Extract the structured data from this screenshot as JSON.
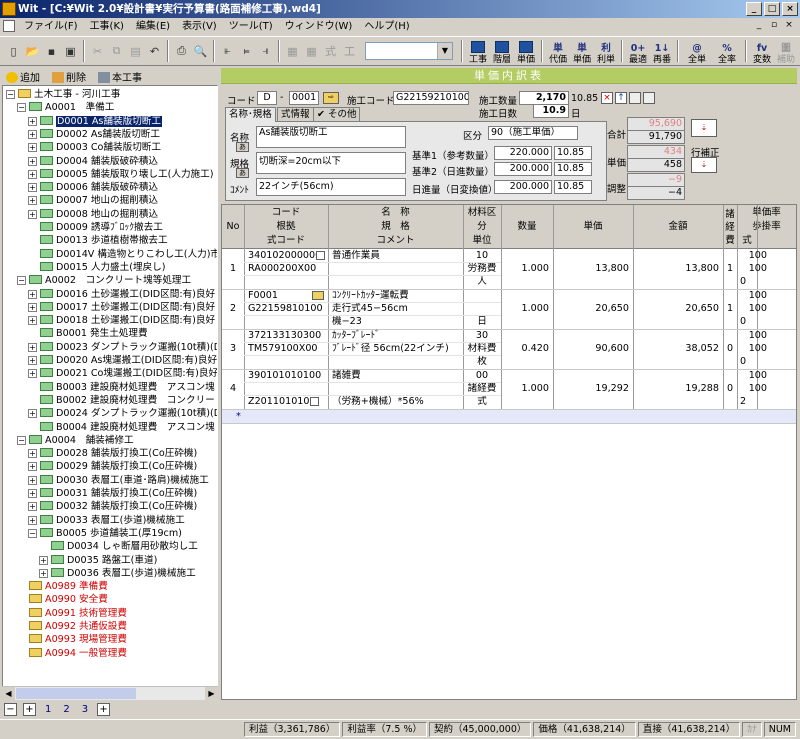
{
  "titlebar": {
    "title": "Wit - [C:¥Wit 2.0¥設計書¥実行予算書(路面補修工事).wd4]",
    "buttons": [
      "_",
      "□",
      "×"
    ]
  },
  "menu": [
    "ファイル(F)",
    "工事(K)",
    "編集(E)",
    "表示(V)",
    "ツール(T)",
    "ウィンドウ(W)",
    "ヘルプ(H)"
  ],
  "toolbar": {
    "big": [
      {
        "label": "工事",
        "icon": "grid-icon"
      },
      {
        "label": "階層",
        "icon": "grid-icon"
      },
      {
        "label": "単価",
        "icon": "grid-icon"
      },
      {
        "label": "代価",
        "glyph": "単",
        "icon": "table-icon"
      },
      {
        "label": "単価",
        "glyph": "単",
        "icon": "table-icon"
      },
      {
        "label": "利単",
        "glyph": "利",
        "icon": "table-icon"
      },
      {
        "label": "最適",
        "glyph": "0+",
        "icon": "optimize-icon"
      },
      {
        "label": "再番",
        "glyph": "1↓",
        "icon": "renumber-icon"
      },
      {
        "label": "全単",
        "glyph": "@",
        "icon": "at-icon"
      },
      {
        "label": "全率",
        "glyph": "%",
        "icon": "percent-icon"
      },
      {
        "label": "変数",
        "glyph": "fv",
        "icon": "variable-icon"
      },
      {
        "label": "補助",
        "glyph": "圖",
        "icon": "aux-icon"
      }
    ]
  },
  "left": {
    "add_label": "追加",
    "delete_label": "削除",
    "book_label": "本工事",
    "tree": [
      {
        "text": "土木工事 - 河川工事",
        "level": 0,
        "exp": "-",
        "folder": "y"
      },
      {
        "text": "A0001　準備工",
        "level": 1,
        "exp": "-",
        "folder": "g"
      },
      {
        "text": "D0001 As舗装版切断工",
        "level": 2,
        "exp": "+",
        "folder": "g",
        "selected": true
      },
      {
        "text": "D0002 As舗装版切断工",
        "level": 2,
        "exp": "+",
        "folder": "g"
      },
      {
        "text": "D0003 Co舗装版切断工",
        "level": 2,
        "exp": "+",
        "folder": "g"
      },
      {
        "text": "D0004 舗装版破砕積込",
        "level": 2,
        "exp": "+",
        "folder": "g"
      },
      {
        "text": "D0005 舗装版取り壊し工(人力施工)",
        "level": 2,
        "exp": "+",
        "folder": "g"
      },
      {
        "text": "D0006 舗装版破砕積込",
        "level": 2,
        "exp": "+",
        "folder": "g"
      },
      {
        "text": "D0007 地山の掘削積込",
        "level": 2,
        "exp": "+",
        "folder": "g"
      },
      {
        "text": "D0008 地山の掘削積込",
        "level": 2,
        "exp": "+",
        "folder": "g"
      },
      {
        "text": "D0009 誘導ﾌﾞﾛｯｸ撤去工",
        "level": 2,
        "exp": "",
        "folder": "g"
      },
      {
        "text": "D0013 歩道植樹帯撤去工",
        "level": 2,
        "exp": "",
        "folder": "g"
      },
      {
        "text": "D0014V 構造物とりこわし工(人力)市場単",
        "level": 2,
        "exp": "",
        "folder": "g"
      },
      {
        "text": "D0015 人力盛土(埋戻し)",
        "level": 2,
        "exp": "",
        "folder": "g"
      },
      {
        "text": "A0002　コンクリート塊等処理工",
        "level": 1,
        "exp": "-",
        "folder": "g"
      },
      {
        "text": "D0016 土砂運搬工(DID区間:有)良好",
        "level": 2,
        "exp": "+",
        "folder": "g"
      },
      {
        "text": "D0017 土砂運搬工(DID区間:有)良好",
        "level": 2,
        "exp": "+",
        "folder": "g"
      },
      {
        "text": "D0018 土砂運搬工(DID区間:有)良好",
        "level": 2,
        "exp": "+",
        "folder": "g"
      },
      {
        "text": "B0001 発生土処理費",
        "level": 2,
        "exp": "",
        "folder": "g"
      },
      {
        "text": "D0023 ダンプトラック運搬(10t積)(DID区間",
        "level": 2,
        "exp": "+",
        "folder": "g"
      },
      {
        "text": "D0020 As塊運搬工(DID区間:有)良好",
        "level": 2,
        "exp": "+",
        "folder": "g"
      },
      {
        "text": "D0021 Co塊運搬工(DID区間:有)良好",
        "level": 2,
        "exp": "+",
        "folder": "g"
      },
      {
        "text": "B0003 建設廃材処理費　アスコン塊",
        "level": 2,
        "exp": "",
        "folder": "g"
      },
      {
        "text": "B0002 建設廃材処理費　コンクリート塊(無",
        "level": 2,
        "exp": "",
        "folder": "g"
      },
      {
        "text": "D0024 ダンプトラック運搬(10t積)(DID区間",
        "level": 2,
        "exp": "+",
        "folder": "g"
      },
      {
        "text": "B0004 建設廃材処理費　アスコン塊",
        "level": 2,
        "exp": "",
        "folder": "g"
      },
      {
        "text": "A0004　舗装補修工",
        "level": 1,
        "exp": "-",
        "folder": "g"
      },
      {
        "text": "D0028 舗装版打換工(Co圧砕機)",
        "level": 2,
        "exp": "+",
        "folder": "g"
      },
      {
        "text": "D0029 舗装版打換工(Co圧砕機)",
        "level": 2,
        "exp": "+",
        "folder": "g"
      },
      {
        "text": "D0030 表層工(車道･路肩)機械施工",
        "level": 2,
        "exp": "+",
        "folder": "g"
      },
      {
        "text": "D0031 舗装版打換工(Co圧砕機)",
        "level": 2,
        "exp": "+",
        "folder": "g"
      },
      {
        "text": "D0032 舗装版打換工(Co圧砕機)",
        "level": 2,
        "exp": "+",
        "folder": "g"
      },
      {
        "text": "D0033 表層工(歩道)機械施工",
        "level": 2,
        "exp": "+",
        "folder": "g"
      },
      {
        "text": "B0005 歩道舗装工(厚19cm)",
        "level": 2,
        "exp": "-",
        "folder": "g"
      },
      {
        "text": "D0034 しゃ断層用砂散均し工",
        "level": 3,
        "exp": "",
        "folder": "g"
      },
      {
        "text": "D0035 路盤工(車道)",
        "level": 3,
        "exp": "+",
        "folder": "g"
      },
      {
        "text": "D0036 表層工(歩道)機械施工",
        "level": 3,
        "exp": "+",
        "folder": "g"
      },
      {
        "text": "A0989 準備費",
        "level": 1,
        "exp": "",
        "folder": "y",
        "red": true
      },
      {
        "text": "A0990 安全費",
        "level": 1,
        "exp": "",
        "folder": "y",
        "red": true
      },
      {
        "text": "A0991 技術管理費",
        "level": 1,
        "exp": "",
        "folder": "y",
        "red": true
      },
      {
        "text": "A0992 共通仮設費",
        "level": 1,
        "exp": "",
        "folder": "y",
        "red": true
      },
      {
        "text": "A0993 現場管理費",
        "level": 1,
        "exp": "",
        "folder": "y",
        "red": true
      },
      {
        "text": "A0994 一般管理費",
        "level": 1,
        "exp": "",
        "folder": "y",
        "red": true
      }
    ],
    "levels": [
      "1",
      "2",
      "3"
    ]
  },
  "detail": {
    "header": "単価内訳表",
    "code_label": "コード",
    "code1": "D",
    "code2": "0001",
    "sekou_label": "施工コード",
    "sekou_code": "G22159210100",
    "sekou_qty_label": "施工数量",
    "sekou_qty": "2,170",
    "sekou_qty_unit": "10.85",
    "sekou_days_label": "施工日数",
    "sekou_days": "10.9",
    "days_unit": "日",
    "tabs": [
      "名称･規格",
      "式情報",
      "✔ その他"
    ],
    "meisho_label": "名称",
    "meisho": "As舗装版切断工",
    "kikaku_label": "規格",
    "kikaku": "切断深=20cm以下",
    "comment_label": "ｺﾒﾝﾄ",
    "comment": "22インチ(56cm)",
    "kubun_label": "区分",
    "kubun": "90（施工単価）",
    "kijun1_label": "基準1（参考数量）",
    "kijun1": "220.000",
    "kijun1_u": "10.85",
    "kijun2_label": "基準2（日進数量）",
    "kijun2": "200.000",
    "kijun2_u": "10.85",
    "nisshin_label": "日進量（日変換値）",
    "nisshin": "200.000",
    "nisshin_u": "10.85",
    "goukei_label": "合計",
    "goukei_1": "95,690",
    "goukei_2": "91,790",
    "tanka_label": "単価",
    "tanka_1": "434",
    "tanka_2": "458",
    "chousei_label": "調整",
    "chousei_1": "−9",
    "chousei_2": "−4",
    "gyou_label": "行補正"
  },
  "grid": {
    "headers": {
      "no": "No",
      "code": "コード",
      "konkyo": "根拠",
      "shiki": "式コード",
      "meisho": "名　称",
      "kikaku": "規　格",
      "comment": "コメント",
      "zairyo": "材料区",
      "bun": "分",
      "tani": "単位",
      "suryo": "数量",
      "tanka": "単価",
      "kingaku": "金額",
      "sho1": "諸",
      "sho2": "経",
      "sho3": "費",
      "tankaritsu": "単価率",
      "buritsu": "歩掛率",
      "shikih": "式"
    },
    "rows": [
      {
        "no": "1",
        "code": "340102000000",
        "konkyo": "RA000200X00",
        "shiki": "",
        "meisho": "普通作業員",
        "kikaku": "",
        "comment": "",
        "zairyo": "10",
        "bun": "労務費",
        "tani": "人",
        "suryo": "1.000",
        "tanka": "13,800",
        "kingaku": "13,800",
        "sho": "1",
        "r1": "100",
        "r2": "100",
        "r3": "0"
      },
      {
        "no": "2",
        "code": "F0001",
        "konkyo": "G22159810100",
        "shiki": "",
        "meisho": "ｺﾝｸﾘｰﾄｶｯﾀｰ運転費",
        "kikaku": "走行式45−56cm",
        "comment": "",
        "zairyo": "",
        "bun": "",
        "tani": "日",
        "suryo": "1.000",
        "tanka": "20,650",
        "kingaku": "20,650",
        "sho": "1",
        "r1": "100",
        "r2": "100",
        "r3": "0",
        "extra": "機−23"
      },
      {
        "no": "3",
        "code": "372133130300",
        "konkyo": "TM579100X00",
        "shiki": "",
        "meisho": "ｶｯﾀｰﾌﾞﾚｰﾄﾞ",
        "kikaku": "ﾌﾞﾚｰﾄﾞ径 56cm(22インチ)",
        "comment": "",
        "zairyo": "30",
        "bun": "材料費",
        "tani": "枚",
        "suryo": "0.420",
        "tanka": "90,600",
        "kingaku": "38,052",
        "sho": "0",
        "r1": "100",
        "r2": "100",
        "r3": "0"
      },
      {
        "no": "4",
        "code": "390101010100",
        "konkyo": "",
        "shiki": "Z201101010",
        "meisho": "諸雑費",
        "kikaku": "",
        "comment": "（労務+機械）*56%",
        "zairyo": "00",
        "bun": "諸経費",
        "tani": "式",
        "suryo": "1.000",
        "tanka": "19,292",
        "kingaku": "19,288",
        "sho": "0",
        "r1": "100",
        "r2": "100",
        "r3": "2"
      }
    ],
    "newrow": "*"
  },
  "status": {
    "rieki": "利益（3,361,786）",
    "riekiritsu": "利益率（7.5 %）",
    "keiyaku": "契約（45,000,000）",
    "kakaku": "価格（41,638,214）",
    "chokusetsu": "直接（41,638,214）",
    "kana": "ｶﾅ",
    "num": "NUM"
  }
}
